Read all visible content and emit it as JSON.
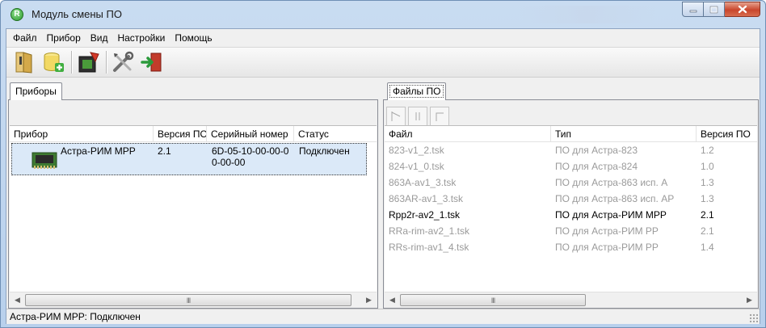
{
  "window": {
    "title": "Модуль смены ПО",
    "icon_letter": "R",
    "icon": "app-logo-icon",
    "controls": [
      "minimize-icon",
      "maximize-icon",
      "close-icon"
    ]
  },
  "menu": {
    "items": [
      {
        "label": "Файл"
      },
      {
        "label": "Прибор"
      },
      {
        "label": "Вид"
      },
      {
        "label": "Настройки"
      },
      {
        "label": "Помощь"
      }
    ]
  },
  "toolbar": {
    "buttons": [
      "open-icon",
      "add-database-icon",
      "device-update-icon",
      "settings-tools-icon",
      "exit-icon"
    ]
  },
  "devices_panel": {
    "tab": "Приборы",
    "columns": [
      "Прибор",
      "Версия ПО",
      "Серийный номер",
      "Статус"
    ],
    "rows": [
      {
        "device": "Астра-РИМ МРР",
        "version": "2.1",
        "serial_line1": "6D-05-10-00-00-0",
        "serial_line2": "0-00-00",
        "status": "Подключен"
      }
    ],
    "scroll_thumb": "III"
  },
  "files_panel": {
    "tab": "Файлы ПО",
    "tool_buttons": [
      "flag-icon",
      "pause-icon",
      "stop-icon"
    ],
    "columns": [
      "Файл",
      "Тип",
      "Версия ПО"
    ],
    "rows": [
      {
        "file": "823-v1_2.tsk",
        "type": "ПО для Астра-823",
        "version": "1.2",
        "active": false
      },
      {
        "file": "824-v1_0.tsk",
        "type": "ПО для Астра-824",
        "version": "1.0",
        "active": false
      },
      {
        "file": "863A-av1_3.tsk",
        "type": "ПО для Астра-863 исп. А",
        "version": "1.3",
        "active": false
      },
      {
        "file": "863AR-av1_3.tsk",
        "type": "ПО для Астра-863 исп. АР",
        "version": "1.3",
        "active": false
      },
      {
        "file": "Rpp2r-av2_1.tsk",
        "type": "ПО для Астра-РИМ МРР",
        "version": "2.1",
        "active": true
      },
      {
        "file": "RRa-rim-av2_1.tsk",
        "type": "ПО для Астра-РИМ РР",
        "version": "2.1",
        "active": false
      },
      {
        "file": "RRs-rim-av1_4.tsk",
        "type": "ПО для Астра-РИМ РР",
        "version": "1.4",
        "active": false
      }
    ],
    "scroll_thumb": "III"
  },
  "status_bar": {
    "text": "Астра-РИМ МРР: Подключен"
  }
}
